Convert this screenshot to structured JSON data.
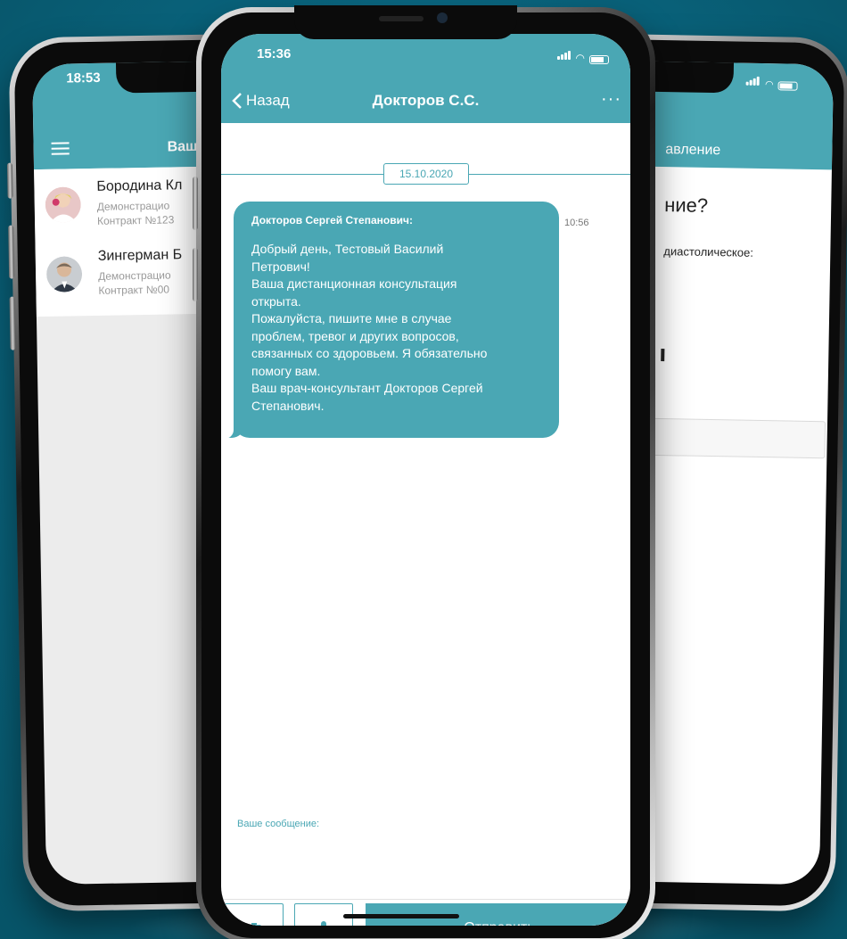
{
  "colors": {
    "accent": "#4aa7b4",
    "background": "#0a6680"
  },
  "left_phone": {
    "time": "18:53",
    "header_title": "Ваш",
    "contacts": [
      {
        "name": "Бородина Кл",
        "line1": "Демонстрацио",
        "line2": "Контракт №123",
        "avatar": "doctor-avatar"
      },
      {
        "name": "Зингерман Б",
        "line1": "Демонстрацио",
        "line2": "Контракт №00",
        "avatar": "doctor-avatar"
      }
    ]
  },
  "center_phone": {
    "time": "15:36",
    "back_label": "Назад",
    "title": "Докторов С.С.",
    "more_label": "···",
    "date": "15.10.2020",
    "message": {
      "author": "Докторов Сергей Степанович:",
      "text": "Добрый день, Тестовый Василий\nПетрович!\nВаша дистанционная консультация\nоткрыта.\nПожалуйста, пишите мне в случае\nпроблем, тревог и других вопросов,\nсвязанных со здоровьем. Я обязательно\nпомогу вам.\nВаш врач-консультант Докторов Сергей\nСтепанович.",
      "time": "10:56"
    },
    "input_label": "Ваше сообщение:",
    "send_label": "Отправить",
    "icons": {
      "camera": "camera-icon",
      "mic": "microphone-icon"
    }
  },
  "right_phone": {
    "header_title": "авление",
    "question": "ние?",
    "field_label": "диастолическое:"
  }
}
